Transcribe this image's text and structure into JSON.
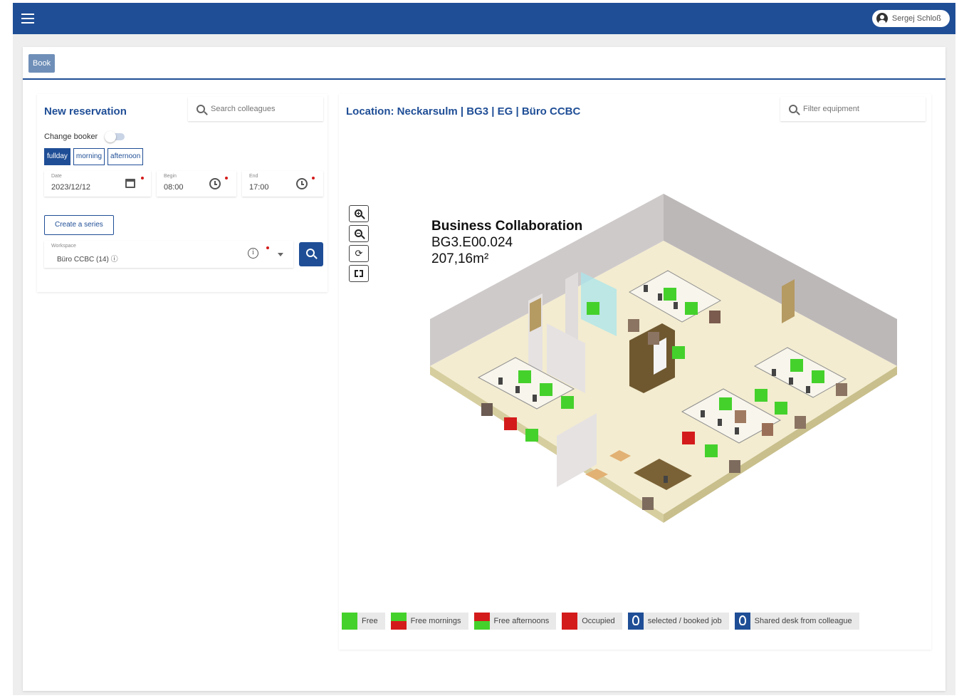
{
  "topbar": {
    "user_name": "Sergej Schloß"
  },
  "tabs": [
    {
      "label": "Book",
      "active": true
    }
  ],
  "reservation": {
    "title": "New reservation",
    "search_placeholder": "Search colleagues",
    "change_booker_label": "Change booker",
    "segments": [
      "fullday",
      "morning",
      "afternoon"
    ],
    "active_segment": "fullday",
    "date": {
      "label": "Date",
      "value": "2023/12/12"
    },
    "begin": {
      "label": "Begin",
      "value": "08:00"
    },
    "end": {
      "label": "End",
      "value": "17:00"
    },
    "create_series_label": "Create a series",
    "workspace": {
      "label": "Workspace",
      "value": "Büro CCBC (14) ⓘ"
    }
  },
  "map": {
    "location_title": "Location: Neckarsulm | BG3 | EG | Büro CCBC",
    "filter_placeholder": "Filter equipment",
    "room": {
      "name": "Business Collaboration",
      "code": "BG3.E00.024",
      "area": "207,16m²"
    }
  },
  "legend": [
    {
      "label": "Free",
      "kind": "free"
    },
    {
      "label": "Free mornings",
      "kind": "morn"
    },
    {
      "label": "Free afternoons",
      "kind": "aft"
    },
    {
      "label": "Occupied",
      "kind": "occ"
    },
    {
      "label": "selected / booked job",
      "kind": "pin"
    },
    {
      "label": "Shared desk from colleague",
      "kind": "pin"
    }
  ],
  "colors": {
    "primary": "#1f4e96",
    "free": "#45d12c",
    "occupied": "#d41b1b",
    "floor": "#f3ecd0",
    "wall": "#c4bfbf"
  }
}
